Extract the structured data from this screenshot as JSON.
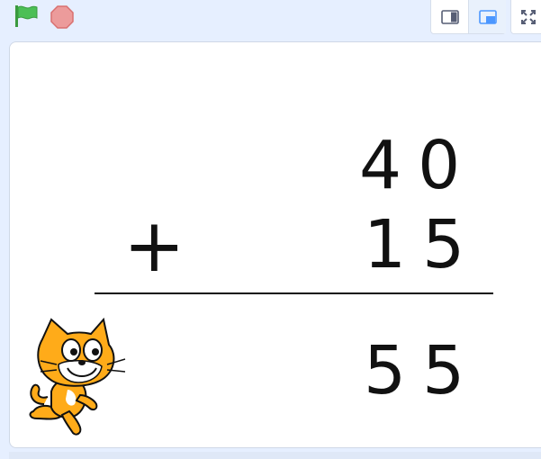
{
  "controls": {
    "green_flag_icon": "green-flag-icon",
    "stop_icon": "stop-sign-icon",
    "small_stage_icon": "small-stage-icon",
    "normal_stage_icon": "normal-stage-icon",
    "fullscreen_icon": "fullscreen-icon"
  },
  "stage": {
    "addend_top": "40",
    "operator": "+",
    "addend_bottom": "15",
    "result": "55",
    "sprite": "cat-sprite"
  },
  "colors": {
    "stage_background": "#ffffff",
    "workspace_background": "#e6efff",
    "flag_green": "#4cbf56",
    "stop_red": "#ec5959",
    "sprite_orange": "#ffab19"
  }
}
